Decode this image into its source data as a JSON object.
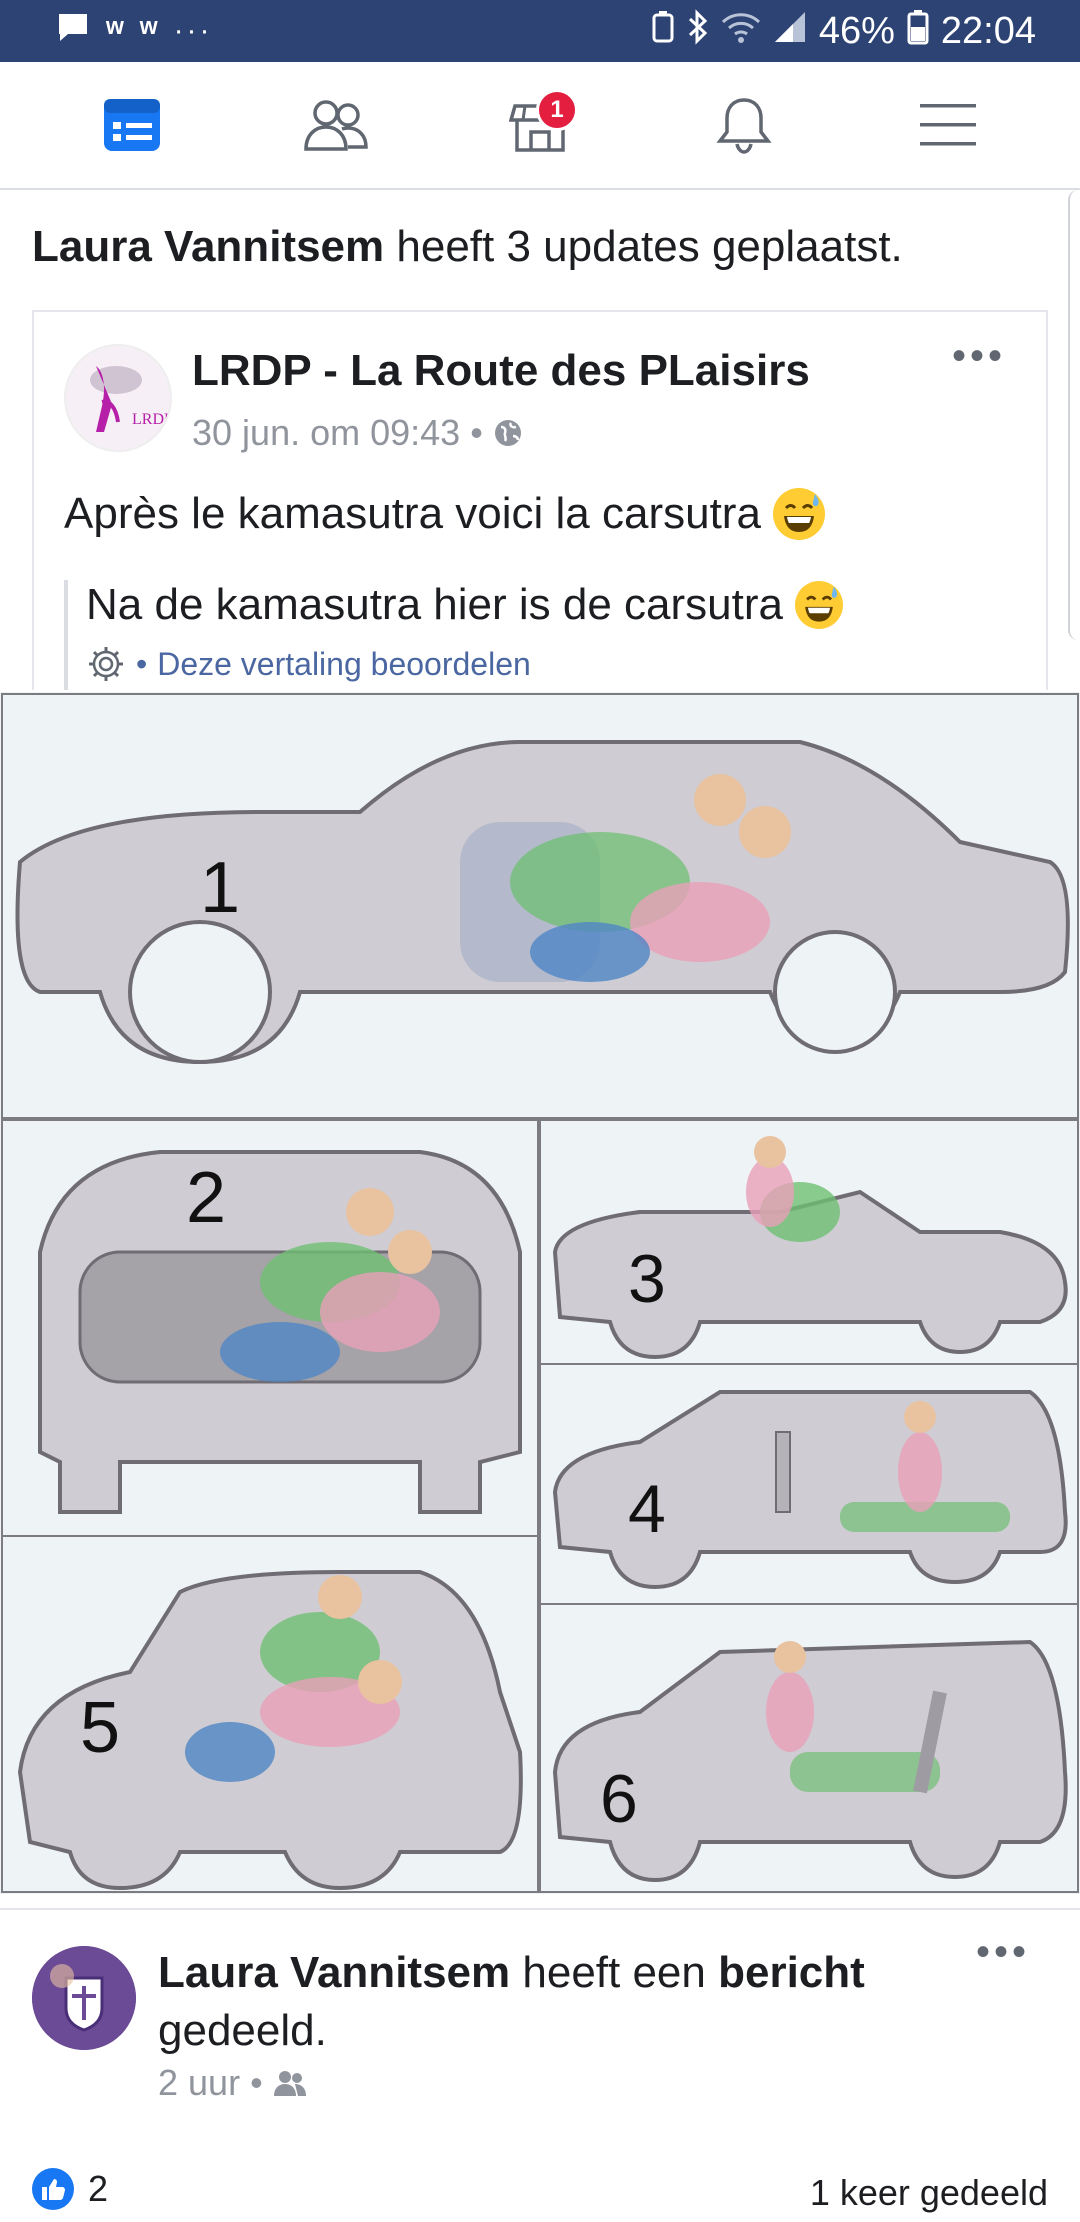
{
  "status_bar": {
    "battery": "46%",
    "time": "22:04",
    "icons": [
      "message-icon",
      "w-app-icon",
      "w-app-icon",
      "more-icon",
      "battery-saver-icon",
      "bluetooth-icon",
      "wifi-icon",
      "signal-icon",
      "battery-icon"
    ]
  },
  "nav": {
    "items": [
      {
        "name": "news-feed",
        "icon": "news-feed-icon",
        "active": true
      },
      {
        "name": "friends",
        "icon": "friends-icon"
      },
      {
        "name": "marketplace",
        "icon": "marketplace-icon",
        "badge": "1"
      },
      {
        "name": "notifications",
        "icon": "bell-icon"
      },
      {
        "name": "menu",
        "icon": "hamburger-icon"
      }
    ],
    "accent": "#1877f2"
  },
  "update": {
    "author": "Laura Vannitsem",
    "text": "heeft 3 updates geplaatst."
  },
  "post": {
    "page_name": "LRDP - La Route des PLaisirs",
    "avatar_label": "LRDP",
    "time": "30 jun. om 09:43",
    "privacy_icon": "globe-icon",
    "text": "Après le kamasutra voici la carsutra",
    "translation": "Na de kamasutra hier is de carsutra",
    "rate_translation": "Deze vertaling beoordelen",
    "image_numbers": [
      "1",
      "2",
      "3",
      "4",
      "5",
      "6"
    ]
  },
  "shared": {
    "author": "Laura Vannitsem",
    "text_mid": "heeft een",
    "text_bold": "bericht",
    "text_end": "gedeeld.",
    "time": "2 uur",
    "audience_icon": "friends-icon",
    "likes": "2",
    "shares": "1 keer gedeeld"
  },
  "colors": {
    "status_bar": "#2d4373",
    "badge": "#e41e3f",
    "link": "#4b67a1",
    "car_fill": "#cfcdd3",
    "car_stroke": "#6f6c74"
  }
}
